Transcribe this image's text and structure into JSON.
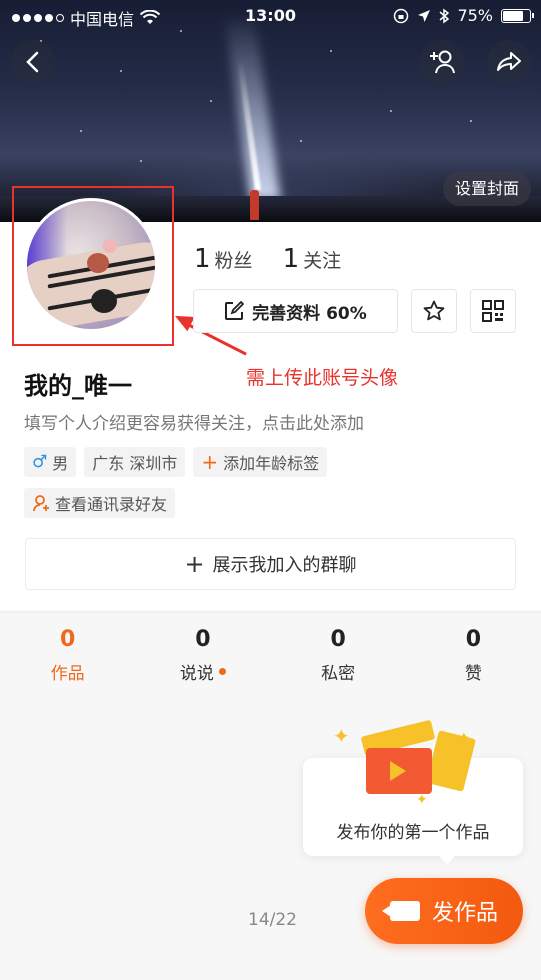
{
  "status_bar": {
    "carrier": "中国电信",
    "time": "13:00",
    "battery": "75%"
  },
  "cover": {
    "set_cover_label": "设置封面"
  },
  "profile": {
    "followers_count": "1",
    "followers_label": "粉丝",
    "following_count": "1",
    "following_label": "关注",
    "edit_label": "完善资料 60%",
    "name": "我的_唯一",
    "bio": "填写个人介绍更容易获得关注，点击此处添加",
    "tags": {
      "gender": "男",
      "location": "广东 深圳市",
      "add_age": "添加年龄标签",
      "contacts": "查看通讯录好友"
    },
    "group_chat_label": "展示我加入的群聊"
  },
  "annotation": {
    "text": "需上传此账号头像",
    "color": "#e8322b"
  },
  "tabs": [
    {
      "count": "0",
      "label": "作品"
    },
    {
      "count": "0",
      "label": "说说"
    },
    {
      "count": "0",
      "label": "私密"
    },
    {
      "count": "0",
      "label": "赞"
    }
  ],
  "tip": {
    "text": "发布你的第一个作品"
  },
  "publish_label": "发作品",
  "page_number": "14/22",
  "colors": {
    "accent": "#f06a1d",
    "annotation_red": "#e8322b"
  }
}
